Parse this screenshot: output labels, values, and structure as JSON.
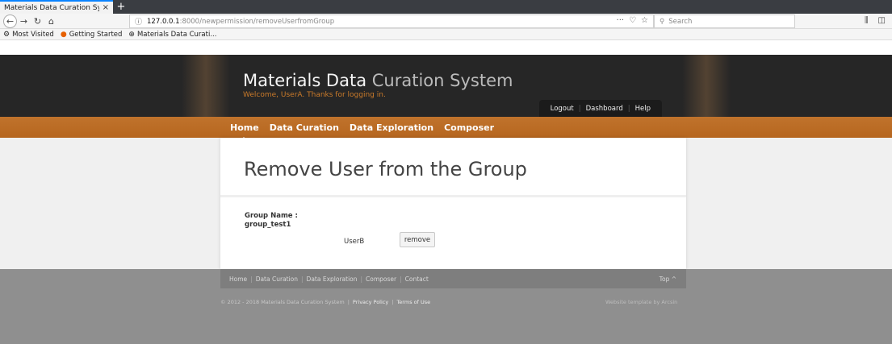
{
  "browser": {
    "tab_title": "Materials Data Curation Sy",
    "tab_close": "×",
    "new_tab": "+",
    "url_host": "127.0.0.1",
    "url_rest": ":8000/newpermission/removeUserfromGroup",
    "search_placeholder": "Search",
    "bookmarks": [
      {
        "label": "Most Visited",
        "icon": "gear-icon"
      },
      {
        "label": "Getting Started",
        "icon": "firefox-icon"
      },
      {
        "label": "Materials Data Curati...",
        "icon": "globe-icon"
      }
    ]
  },
  "site": {
    "title_main": "Materials Data",
    "title_light": "Curation System",
    "welcome": "Welcome, UserA. Thanks for logging in.",
    "util_links": [
      "Logout",
      "Dashboard",
      "Help"
    ],
    "nav": [
      "Home",
      "Data Curation",
      "Data Exploration",
      "Composer"
    ],
    "accent_color": "#c0732c"
  },
  "main": {
    "page_title": "Remove User from the Group",
    "group_label": "Group Name :",
    "group_name": "group_test1",
    "user": "UserB",
    "remove_label": "remove"
  },
  "footer": {
    "links": [
      "Home",
      "Data Curation",
      "Data Exploration",
      "Composer",
      "Contact"
    ],
    "top_label": "Top ^",
    "copyright": "© 2012 - 2018 Materials Data Curation System",
    "privacy": "Privacy Policy",
    "terms": "Terms of Use",
    "credit": "Website template by Arcsin"
  }
}
